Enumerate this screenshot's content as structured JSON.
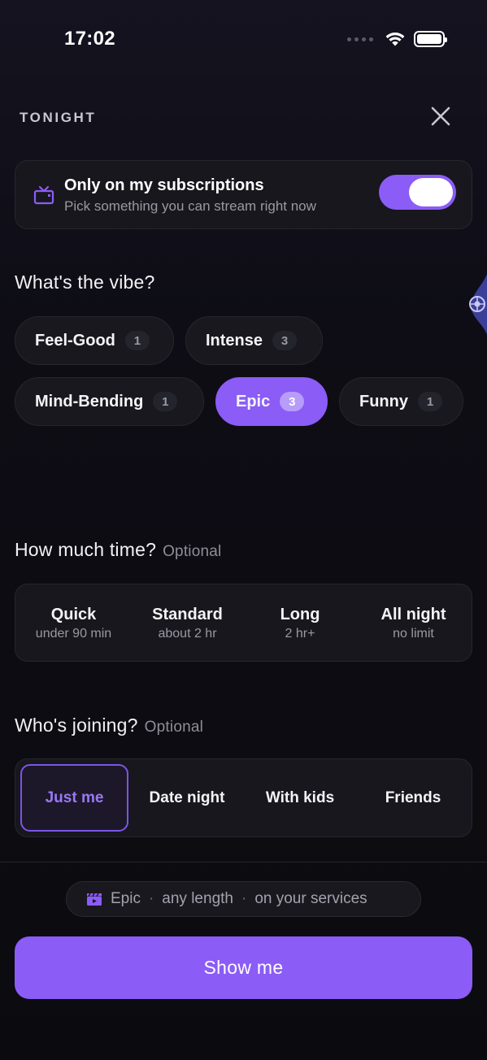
{
  "status_bar": {
    "time": "17:02"
  },
  "header": {
    "label": "TONIGHT"
  },
  "subscriptions": {
    "title": "Only on my subscriptions",
    "subtitle": "Pick something you can stream right now",
    "toggle_on": true,
    "icon": "tv-icon"
  },
  "vibe": {
    "title": "What's the vibe?",
    "chips": [
      {
        "label": "Feel-Good",
        "count": "1",
        "selected": false
      },
      {
        "label": "Intense",
        "count": "3",
        "selected": false
      },
      {
        "label": "Mind-Bending",
        "count": "1",
        "selected": false
      },
      {
        "label": "Epic",
        "count": "3",
        "selected": true
      },
      {
        "label": "Funny",
        "count": "1",
        "selected": false
      }
    ]
  },
  "time": {
    "title": "How much time?",
    "optional": "Optional",
    "options": [
      {
        "label": "Quick",
        "sub": "under 90 min"
      },
      {
        "label": "Standard",
        "sub": "about 2 hr"
      },
      {
        "label": "Long",
        "sub": "2 hr+"
      },
      {
        "label": "All night",
        "sub": "no limit"
      }
    ]
  },
  "who": {
    "title": "Who's joining?",
    "optional": "Optional",
    "options": [
      {
        "label": "Just me",
        "selected": true
      },
      {
        "label": "Date night",
        "selected": false
      },
      {
        "label": "With kids",
        "selected": false
      },
      {
        "label": "Friends",
        "selected": false
      }
    ]
  },
  "summary": {
    "icon": "clapperboard-icon",
    "vibe": "Epic",
    "separator": "·",
    "length": "any length",
    "services": "on your services"
  },
  "cta": {
    "label": "Show me"
  },
  "colors": {
    "accent": "#8b5cf6",
    "background": "#0b0b0f",
    "card": "#17171d",
    "muted_text": "#9a99a4"
  }
}
